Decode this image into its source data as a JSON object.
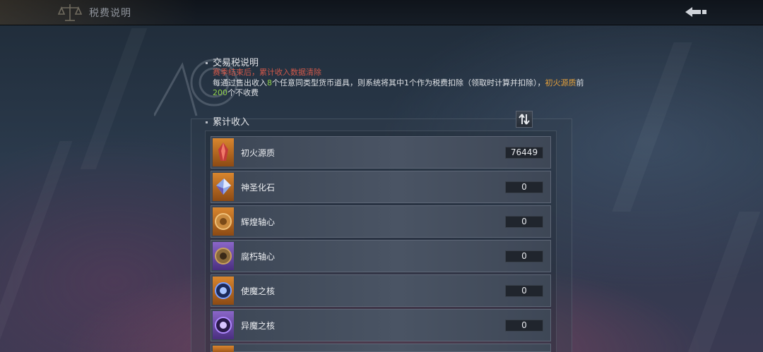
{
  "header": {
    "title": "税费说明"
  },
  "tax_section": {
    "heading": "交易税说明",
    "warning": "赛季结束后，累计收入数据清除",
    "desc_part1": "每通过售出收入",
    "desc_num1": "8",
    "desc_part2": "个任意同类型货币道具，则系统将其中",
    "desc_num2": "1",
    "desc_part3": "个作为税费扣除（领取时计算并扣除），",
    "desc_item": "初火源质",
    "desc_part4": "前",
    "desc_num3": "200",
    "desc_part5": "个不收费"
  },
  "income_section": {
    "heading": "累计收入"
  },
  "items": [
    {
      "name": "初火源质",
      "value": "76449",
      "icon": "red-crystal-icon"
    },
    {
      "name": "神圣化石",
      "value": "0",
      "icon": "holy-gem-icon"
    },
    {
      "name": "辉煌轴心",
      "value": "0",
      "icon": "golden-gear-icon"
    },
    {
      "name": "腐朽轴心",
      "value": "0",
      "icon": "rotten-gear-icon"
    },
    {
      "name": "使魔之核",
      "value": "0",
      "icon": "blue-core-icon"
    },
    {
      "name": "异魔之核",
      "value": "0",
      "icon": "violet-core-icon"
    }
  ],
  "colors": {
    "warning": "#d0584a",
    "highlight_green": "#8fd14a",
    "highlight_orange": "#e5a13c",
    "orange_frame": "#d9862e",
    "purple_frame": "#8a66c8"
  }
}
